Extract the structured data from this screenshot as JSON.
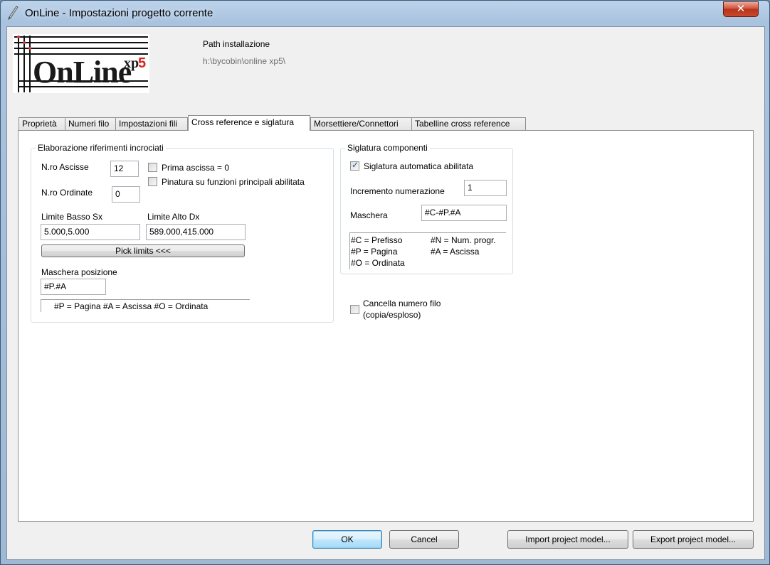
{
  "window": {
    "title": "OnLine - Impostazioni progetto corrente",
    "close_label": "✕"
  },
  "logo": {
    "text": "OnLine",
    "xp": "xp",
    "num": "5"
  },
  "install": {
    "label": "Path installazione",
    "value": "h:\\bycobin\\online xp5\\"
  },
  "tabs": [
    {
      "label": "Proprietà"
    },
    {
      "label": "Numeri filo"
    },
    {
      "label": "Impostazioni fili"
    },
    {
      "label": "Cross reference e siglatura"
    },
    {
      "label": "Morsettiere/Connettori"
    },
    {
      "label": "Tabelline cross reference"
    }
  ],
  "xref": {
    "title": "Elaborazione riferimenti incrociati",
    "nro_ascisse_label": "N.ro Ascisse",
    "nro_ascisse_value": "12",
    "nro_ordinate_label": "N.ro Ordinate",
    "nro_ordinate_value": "0",
    "prima_ascissa_label": "Prima ascissa = 0",
    "pinatura_label": "Pinatura su funzioni principali abilitata",
    "limite_basso_label": "Limite Basso Sx",
    "limite_basso_value": "5.000,5.000",
    "limite_alto_label": "Limite Alto Dx",
    "limite_alto_value": "589.000,415.000",
    "pick_limits_label": "Pick limits <<<",
    "maschera_label": "Maschera posizione",
    "maschera_value": "#P.#A",
    "hint": "#P = Pagina   #A = Ascissa   #O = Ordinata"
  },
  "sigla": {
    "title": "Siglatura componenti",
    "auto_label": "Siglatura automatica abilitata",
    "incremento_label": "Incremento numerazione",
    "incremento_value": "1",
    "maschera_label": "Maschera",
    "maschera_value": "#C-#P.#A",
    "hint_c": "#C = Prefisso",
    "hint_n": "#N = Num. progr.",
    "hint_p": "#P = Pagina",
    "hint_a": "#A = Ascissa",
    "hint_o": "#O = Ordinata"
  },
  "cancella": {
    "line1": "Cancella numero filo",
    "line2": "(copia/esploso)"
  },
  "footer": {
    "ok": "OK",
    "cancel": "Cancel",
    "import": "Import project model...",
    "export": "Export project model..."
  },
  "colors": {
    "logo_text": "#1a1a1a",
    "logo_accent": "#d7231e",
    "close_button": "#c94a2c",
    "default_button_border": "#3c7fb1"
  }
}
